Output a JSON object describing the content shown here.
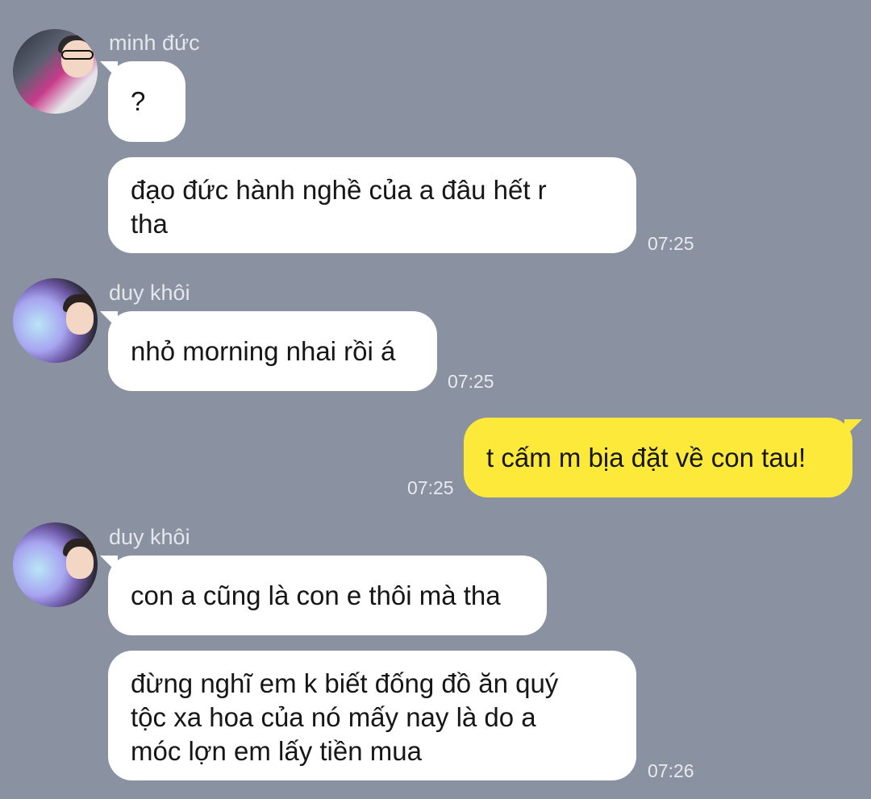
{
  "messages": [
    {
      "sender": "minh đức",
      "avatar": "avatar-minh-duc",
      "texts": [
        "?",
        "đạo đức hành nghề của a đâu hết r tha"
      ],
      "time": "07:25"
    },
    {
      "sender": "duy khôi",
      "avatar": "avatar-duy-khoi",
      "texts": [
        "nhỏ morning nhai rồi á"
      ],
      "time": "07:25"
    },
    {
      "sender": "me",
      "texts": [
        "t cấm m bịa đặt về con tau!"
      ],
      "time": "07:25"
    },
    {
      "sender": "duy khôi",
      "avatar": "avatar-duy-khoi",
      "texts": [
        "con a cũng là con e thôi mà tha",
        "đừng nghĩ em k biết đống đồ ăn quý tộc xa hoa của nó mấy nay là do a móc lợn em lấy tiền mua"
      ],
      "time": "07:26"
    }
  ],
  "colors": {
    "background": "#8a92a1",
    "incoming_bubble": "#ffffff",
    "outgoing_bubble": "#fde93a",
    "sender_name": "#e4e7ec"
  }
}
